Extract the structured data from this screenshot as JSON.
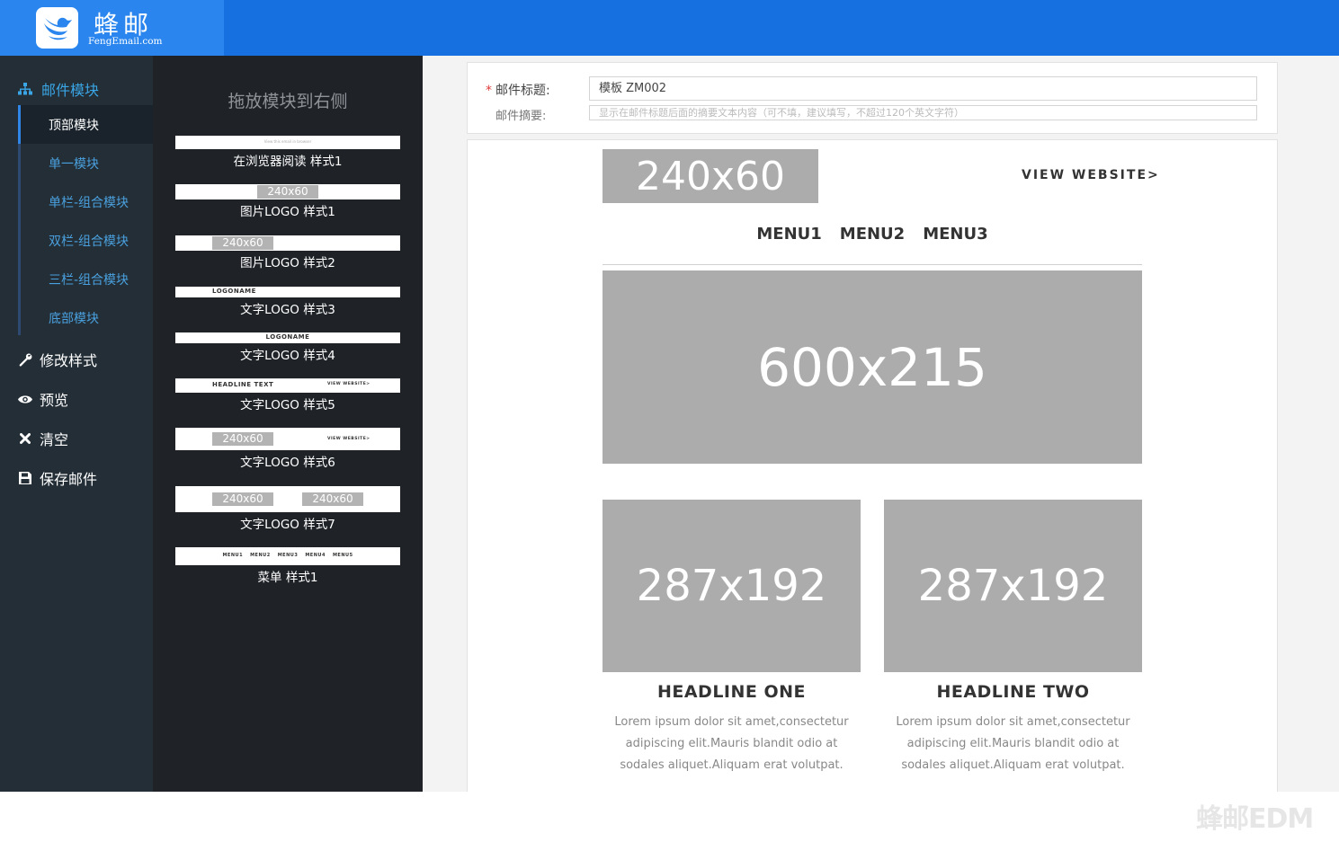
{
  "header": {
    "brand_name": "蜂邮",
    "brand_sub": "FengEmail.com"
  },
  "sidebar": {
    "group_label": "邮件模块",
    "sub_items": [
      {
        "label": "顶部模块",
        "active": true
      },
      {
        "label": "单一模块"
      },
      {
        "label": "单栏-组合模块"
      },
      {
        "label": "双栏-组合模块"
      },
      {
        "label": "三栏-组合模块"
      },
      {
        "label": "底部模块"
      }
    ],
    "items": [
      {
        "label": "修改样式",
        "icon": "wrench-icon"
      },
      {
        "label": "预览",
        "icon": "eye-icon"
      },
      {
        "label": "清空",
        "icon": "close-icon"
      },
      {
        "label": "保存邮件",
        "icon": "save-icon"
      }
    ]
  },
  "modules": {
    "title": "拖放模块到右侧",
    "items": [
      {
        "label": "在浏览器阅读 样式1",
        "preview_text": "View this email in browser"
      },
      {
        "label": "图片LOGO 样式1",
        "ph": "240x60"
      },
      {
        "label": "图片LOGO 样式2",
        "ph": "240x60"
      },
      {
        "label": "文字LOGO 样式3",
        "preview_text": "LOGONAME"
      },
      {
        "label": "文字LOGO 样式4",
        "preview_text": "LOGONAME"
      },
      {
        "label": "文字LOGO 样式5",
        "preview_text": "HEADLINE TEXT",
        "preview_text2": "VIEW WEBSITE>"
      },
      {
        "label": "文字LOGO 样式6",
        "ph": "240x60",
        "preview_text2": "VIEW WEBSITE>"
      },
      {
        "label": "文字LOGO 样式7",
        "ph": "240x60",
        "ph2": "240x60"
      },
      {
        "label": "菜单 样式1",
        "menus": [
          "MENU1",
          "MENU2",
          "MENU3",
          "MENU4",
          "MENU5"
        ]
      }
    ]
  },
  "form": {
    "title_label": "邮件标题:",
    "title_value": "模板 ZM002",
    "summary_label": "邮件摘要:",
    "summary_placeholder": "显示在邮件标题后面的摘要文本内容（可不填，建议填写，不超过120个英文字符）"
  },
  "email": {
    "logo_ph": "240x60",
    "view_website": "VIEW WEBSITE>",
    "menus": [
      "MENU1",
      "MENU2",
      "MENU3"
    ],
    "banner_ph": "600x215",
    "col1": {
      "ph": "287x192",
      "headline": "HEADLINE ONE",
      "text": "Lorem ipsum dolor sit amet,consectetur adipiscing elit.Mauris blandit odio at sodales aliquet.Aliquam erat volutpat."
    },
    "col2": {
      "ph": "287x192",
      "headline": "HEADLINE TWO",
      "text": "Lorem ipsum dolor sit amet,consectetur adipiscing elit.Mauris blandit odio at sodales aliquet.Aliquam erat volutpat."
    }
  },
  "watermark": "蜂邮EDM",
  "colors": {
    "header_blue": "#1670e0",
    "brand_blue": "#2a86ee",
    "nav_bg": "#232e36",
    "panel_bg": "#1f2328",
    "link_blue": "#3aa6e6",
    "placeholder_gray": "#acacac"
  }
}
